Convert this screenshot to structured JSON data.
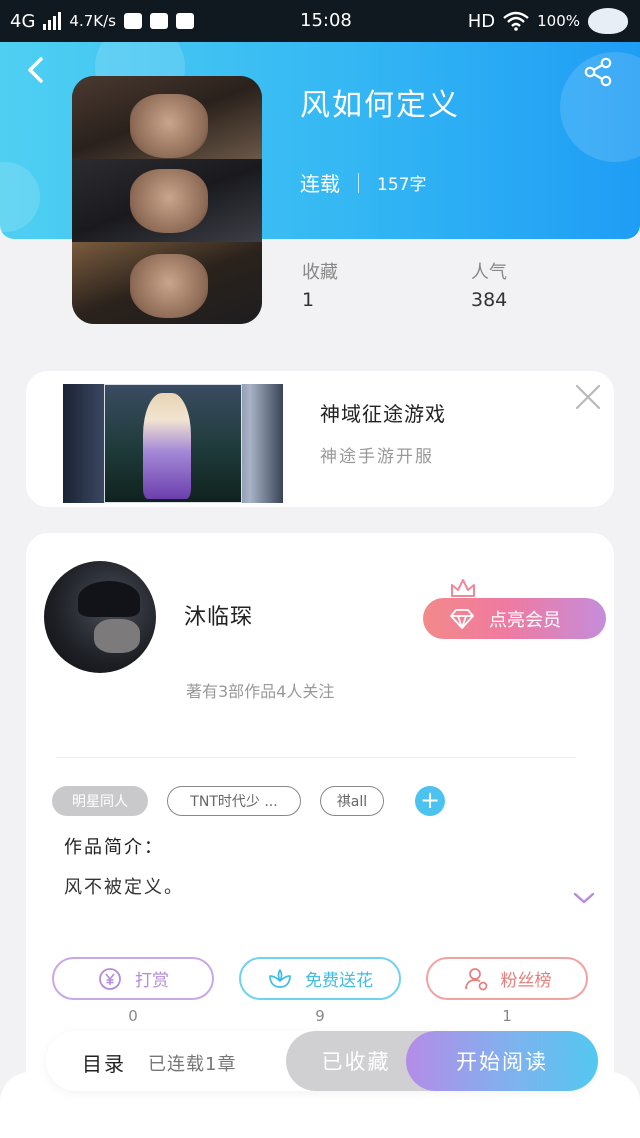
{
  "status_bar": {
    "network": "4G",
    "speed": "4.7K/s",
    "time": "15:08",
    "hd": "HD",
    "battery": "100%"
  },
  "book": {
    "title": "风如何定义",
    "status": "连载",
    "word_count": "157字",
    "favorites_label": "收藏",
    "favorites_value": "1",
    "popularity_label": "人气",
    "popularity_value": "384"
  },
  "ad": {
    "title": "神域征途游戏",
    "subtitle": "神途手游开服"
  },
  "author": {
    "name": "沐临琛",
    "meta": "著有3部作品4人关注",
    "vip_label": "点亮会员"
  },
  "tags": [
    "明星同人",
    "TNT时代少 ...",
    "祺all"
  ],
  "intro": {
    "label": "作品简介：",
    "text": "风不被定义。"
  },
  "actions": [
    {
      "label": "打赏",
      "count": "0",
      "color": "#b58bdc"
    },
    {
      "label": "免费送花",
      "count": "9",
      "color": "#4cc6e6"
    },
    {
      "label": "粉丝榜",
      "count": "1",
      "color": "#ef8a88"
    }
  ],
  "bottom_bar": {
    "toc_label": "目录",
    "chapter_status": "已连载1章",
    "collected_label": "已收藏",
    "read_label": "开始阅读"
  },
  "colors": {
    "header_gradient_start": "#4fd0f2",
    "header_gradient_end": "#1f9df5",
    "accent_blue": "#4cc3ef",
    "vip_gradient_start": "#f28a8a",
    "vip_gradient_end": "#c58ddb"
  },
  "icons": [
    "back-arrow-icon",
    "share-icon",
    "close-icon",
    "crown-icon",
    "diamond-icon",
    "plus-icon",
    "chevron-down-icon",
    "yen-coin-icon",
    "flower-icon",
    "fan-user-icon",
    "signal-icon",
    "wifi-icon",
    "whale-icon"
  ]
}
